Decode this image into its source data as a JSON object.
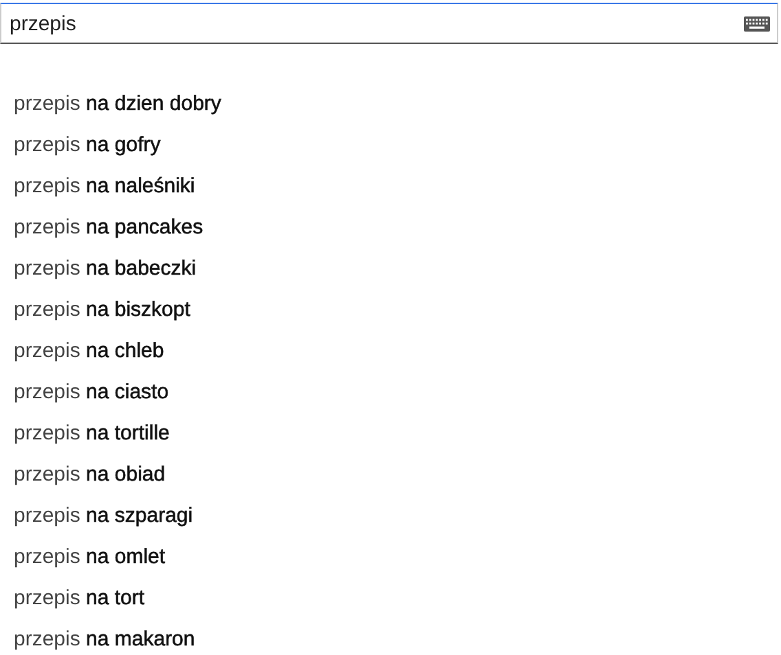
{
  "search": {
    "value": "przepis"
  },
  "suggestions": [
    "przepis **na dzien dobry**",
    "przepis **na gofry**",
    "przepis **na naleśniki**",
    "przepis **na pancakes**",
    "przepis **na babeczki**",
    "przepis **na biszkopt**",
    "przepis **na chleb**",
    "przepis **na ciasto**",
    "przepis **na tortille**",
    "przepis **na obiad**",
    "przepis **na szparagi**",
    "przepis **na omlet**",
    "przepis **na tort**",
    "przepis **na makaron**"
  ]
}
